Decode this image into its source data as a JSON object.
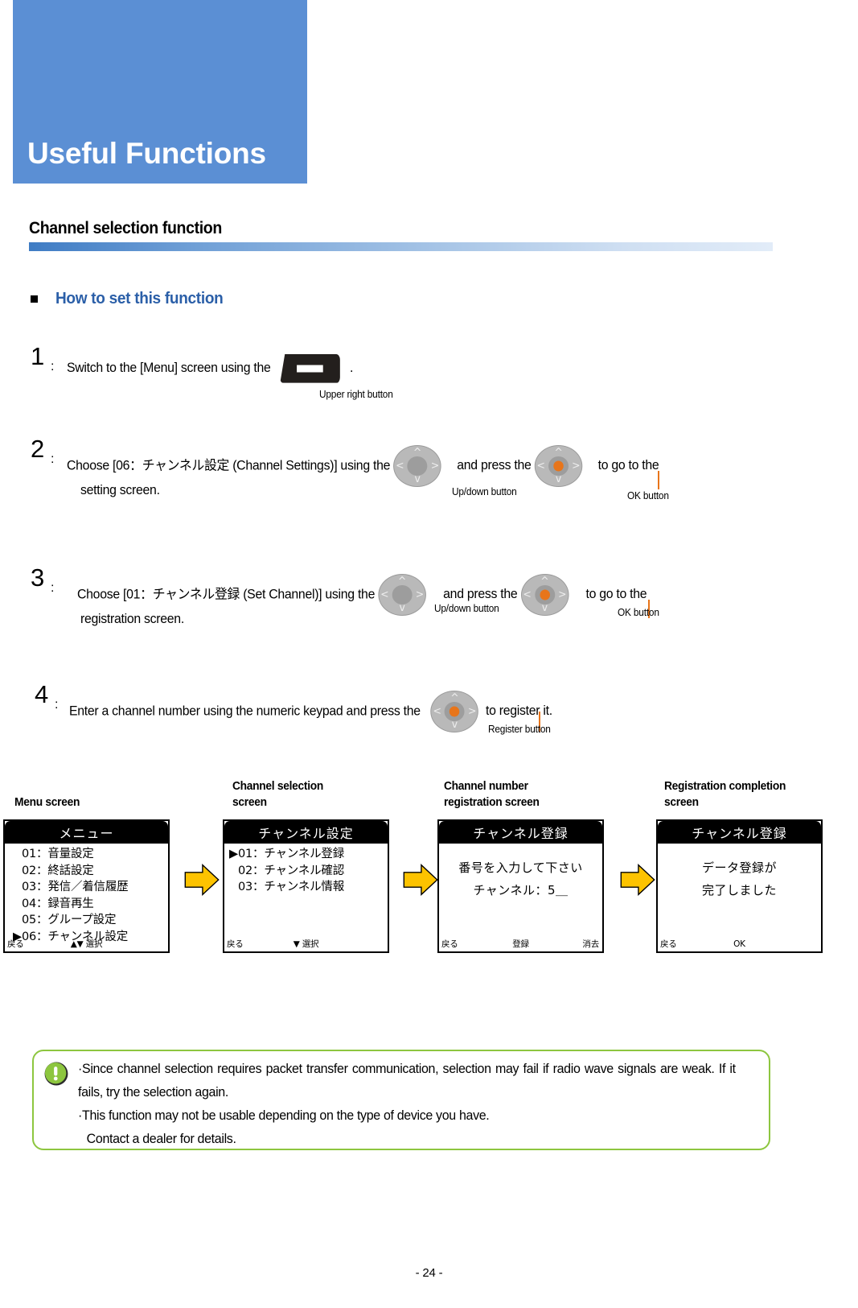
{
  "chapter": {
    "banner_title": "Useful Functions",
    "banner_color": "#5b8fd4"
  },
  "section": {
    "heading": "Channel selection function"
  },
  "subsection": {
    "heading": "How to set this function"
  },
  "steps": [
    {
      "number": "1",
      "colon": ":",
      "text_before": "Switch to the [Menu] screen using the",
      "text_after": ".",
      "icon": "upper-right-button",
      "callout": "Upper right button"
    },
    {
      "number": "2",
      "colon": ":",
      "text_a": "Choose [06：チャンネル設定 (Channel Settings)] using the",
      "text_b": "and press the",
      "text_c": "to go to the",
      "text_d": "setting screen.",
      "callout_left": "Up/down button",
      "callout_right": "OK button"
    },
    {
      "number": "3",
      "colon": ":",
      "text_a": "Choose [01：チャンネル登録 (Set Channel)] using the",
      "text_b": "and press the",
      "text_c": "to go to the",
      "text_d": "registration screen.",
      "callout_left": "Up/down button",
      "callout_right": "OK button"
    },
    {
      "number": "4",
      "colon": ":",
      "text_a": "Enter a channel number using the numeric keypad and press the",
      "text_c": "to register it.",
      "callout_right": "Register button"
    }
  ],
  "screens": [
    {
      "label": "Menu screen",
      "title": "メニュー",
      "rows": [
        {
          "caret": "",
          "text": "01：音量設定"
        },
        {
          "caret": "",
          "text": "02：終話設定"
        },
        {
          "caret": "",
          "text": "03：発信／着信履歴"
        },
        {
          "caret": "",
          "text": "04：録音再生"
        },
        {
          "caret": "",
          "text": "05：グループ設定"
        },
        {
          "caret": "▶",
          "text": "06：チャンネル設定"
        }
      ],
      "footer_left": "戻る",
      "footer_center_icon": "updown-arrow-icon",
      "footer_center": "選択",
      "footer_right": ""
    },
    {
      "label": "Channel selection\nscreen",
      "title": "チャンネル設定",
      "rows": [
        {
          "caret": "▶",
          "text": "01：チャンネル登録"
        },
        {
          "caret": "",
          "text": "02：チャンネル確認"
        },
        {
          "caret": "",
          "text": "03：チャンネル情報"
        }
      ],
      "footer_left": "戻る",
      "footer_center_icon": "down-arrow-icon",
      "footer_center": "選択",
      "footer_right": ""
    },
    {
      "label": "Channel number\nregistration screen",
      "title": "チャンネル登録",
      "center_lines": [
        "番号を入力して下さい",
        "チャンネル：5＿"
      ],
      "footer_left": "戻る",
      "footer_center": "登録",
      "footer_right": "消去"
    },
    {
      "label": "Registration completion\nscreen",
      "title": "チャンネル登録",
      "center_lines": [
        "データ登録が",
        "完了しました"
      ],
      "footer_left": "戻る",
      "footer_center": "OK",
      "footer_right": ""
    }
  ],
  "flow_arrow_color": "#fdc300",
  "note": {
    "icon": "exclamation-icon",
    "icon_color": "#8dc63f",
    "border_color": "#8dc63f",
    "items": [
      "Since channel selection requires packet transfer communication, selection may fail if radio wave signals are weak. If it fails, try the selection again.",
      "This function may not be usable depending on the type of device you have.",
      "Contact a dealer for details."
    ]
  },
  "footer": {
    "page_number": "- 24 -"
  }
}
